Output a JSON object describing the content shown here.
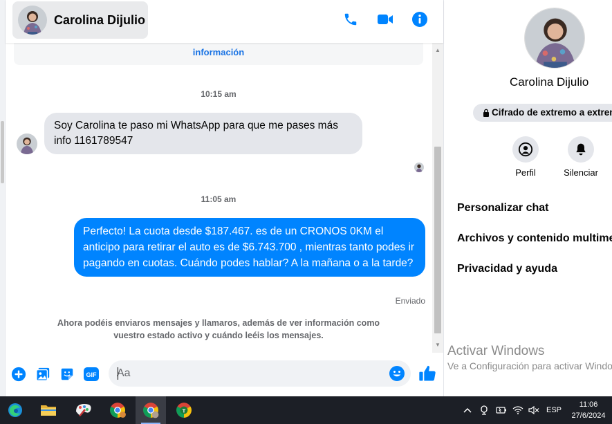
{
  "contact": {
    "name": "Carolina Dijulio"
  },
  "header": {
    "actions": [
      "phone-icon",
      "video-icon",
      "info-icon"
    ]
  },
  "messages": {
    "info_link": "información",
    "time_1": "10:15 am",
    "incoming_text": "Soy Carolina te paso mi WhatsApp  para que me pases más info 1161789547",
    "time_2": "11:05 am",
    "outgoing_text": "Perfecto! La cuota desde $187.467. es de un CRONOS 0KM el anticipo para retirar el auto es de $6.743.700 , mientras tanto podes ir pagando en cuotas. Cuándo podes hablar? A la mañana o a la tarde?",
    "outgoing_status": "Enviado",
    "notice": "Ahora podéis enviaros mensajes y llamaros, además de ver información como vuestro estado activo y cuándo leéis los mensajes."
  },
  "composer": {
    "placeholder": "Aa",
    "tools": [
      "add-icon",
      "photo-icon",
      "sticker-icon",
      "gif-icon"
    ]
  },
  "panel": {
    "name": "Carolina Dijulio",
    "encryption": "Cifrado de extremo a extremo",
    "actions": [
      {
        "label": "Perfil",
        "icon": "profile-icon"
      },
      {
        "label": "Silenciar",
        "icon": "bell-icon"
      }
    ],
    "menu": [
      "Personalizar chat",
      "Archivos y contenido multimedia",
      "Privacidad y ayuda"
    ]
  },
  "watermark": {
    "title": "Activar Windows",
    "subtitle": "Ve a Configuración para activar Windows."
  },
  "taskbar": {
    "apps": [
      "edge-icon",
      "file-explorer-icon",
      "paint-icon",
      "chrome-icon",
      "chrome-profile-icon",
      "chrome-t-icon"
    ],
    "language": "ESP",
    "time": "11:06",
    "date": "27/6/2024"
  },
  "colors": {
    "accent": "#0084ff",
    "incoming_bubble": "#e4e6eb",
    "taskbar": "#1c1f26"
  }
}
